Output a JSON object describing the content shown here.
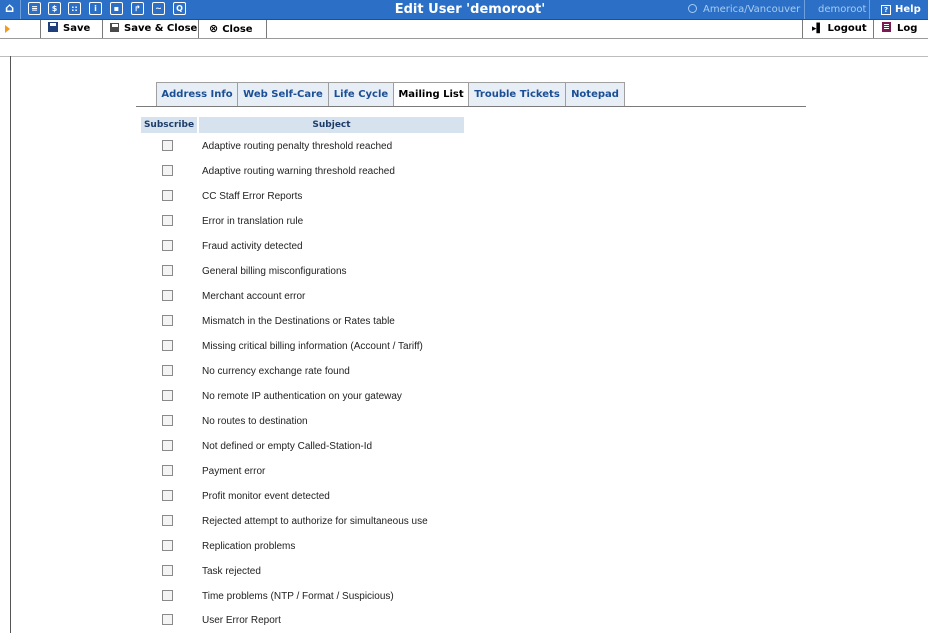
{
  "topbar": {
    "title": "Edit User 'demoroot'",
    "timezone": "America/Vancouver",
    "user": "demoroot",
    "help": "Help"
  },
  "toolbar": {
    "save": "Save",
    "save_close": "Save & Close",
    "close": "Close",
    "logout": "Logout",
    "log": "Log"
  },
  "tabs": [
    "Address Info",
    "Web Self-Care",
    "Life Cycle",
    "Mailing List",
    "Trouble Tickets",
    "Notepad"
  ],
  "table": {
    "headers": [
      "Subscribe",
      "Subject"
    ],
    "rows": [
      "Adaptive routing penalty threshold reached",
      "Adaptive routing warning threshold reached",
      "CC Staff Error Reports",
      "Error in translation rule",
      "Fraud activity detected",
      "General billing misconfigurations",
      "Merchant account error",
      "Mismatch in the Destinations or Rates table",
      "Missing critical billing information (Account / Tariff)",
      "No currency exchange rate found",
      "No remote IP authentication on your gateway",
      "No routes to destination",
      "Not defined or empty Called-Station-Id",
      "Payment error",
      "Profit monitor event detected",
      "Rejected attempt to authorize for simultaneous use",
      "Replication problems",
      "Task rejected",
      "Time problems (NTP / Format / Suspicious)",
      "User Error Report"
    ]
  },
  "colors": {
    "topbar": "#2b6fc6",
    "tab_text": "#1b4f95",
    "header_bg": "#d6e3ee"
  }
}
